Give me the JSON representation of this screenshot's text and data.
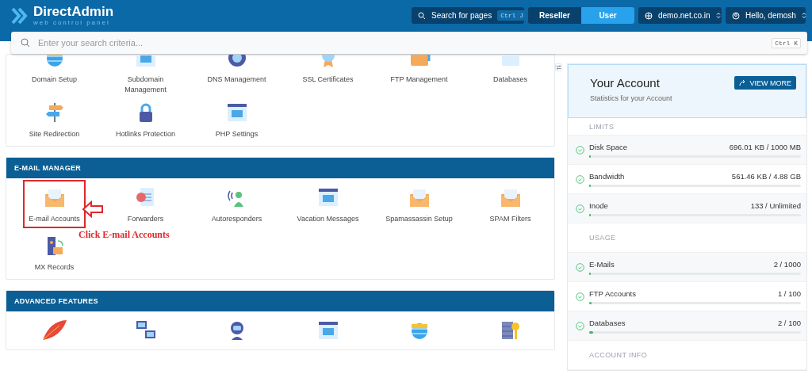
{
  "header": {
    "logo": {
      "name": "DirectAdmin",
      "tagline": "web control panel"
    },
    "page_search": {
      "label": "Search for pages",
      "shortcut": "Ctrl J"
    },
    "roles": [
      {
        "label": "Reseller",
        "selected": false
      },
      {
        "label": "User",
        "selected": true
      }
    ],
    "domain": "demo.net.co.in",
    "user": "Hello, demosh"
  },
  "search": {
    "placeholder": "Enter your search criteria...",
    "shortcut": "Ctrl K"
  },
  "sections": [
    {
      "items": [
        {
          "label": "Domain Setup",
          "highlighted": false
        },
        {
          "label": "Subdomain Management",
          "highlighted": false
        },
        {
          "label": "DNS Management",
          "highlighted": false
        },
        {
          "label": "SSL Certificates",
          "highlighted": false
        },
        {
          "label": "FTP Management",
          "highlighted": false
        },
        {
          "label": "Databases",
          "highlighted": false
        },
        {
          "label": "Site Redirection",
          "highlighted": false
        },
        {
          "label": "Hotlinks Protection",
          "highlighted": false
        },
        {
          "label": "PHP Settings",
          "highlighted": false
        }
      ]
    },
    {
      "title": "E-MAIL MANAGER",
      "annotation": "Click E-mail Accounts",
      "items": [
        {
          "label": "E-mail Accounts",
          "highlighted": true
        },
        {
          "label": "Forwarders",
          "highlighted": false
        },
        {
          "label": "Autoresponders",
          "highlighted": false
        },
        {
          "label": "Vacation Messages",
          "highlighted": false
        },
        {
          "label": "Spamassassin Setup",
          "highlighted": false
        },
        {
          "label": "SPAM Filters",
          "highlighted": false
        },
        {
          "label": "MX Records",
          "highlighted": false
        }
      ]
    },
    {
      "title": "ADVANCED FEATURES"
    }
  ],
  "account": {
    "title": "Your Account",
    "subtitle": "Statistics for your Account",
    "button": "VIEW MORE",
    "rows": [
      {
        "kind": "heading",
        "label": "LIMITS"
      },
      {
        "kind": "stat",
        "label": "Disk Space",
        "reading": "696.01 KB / 1000 MB",
        "level": 0.005
      },
      {
        "kind": "stat",
        "label": "Bandwidth",
        "reading": "561.46 KB / 4.88 GB",
        "level": 0.005
      },
      {
        "kind": "stat",
        "label": "Inode",
        "reading": "133 / Unlimited",
        "level": 0.005
      },
      {
        "kind": "heading",
        "label": "USAGE"
      },
      {
        "kind": "stat",
        "label": "E-Mails",
        "reading": "2 / 1000",
        "level": 0.005
      },
      {
        "kind": "stat",
        "label": "FTP Accounts",
        "reading": "1 / 100",
        "level": 0.01
      },
      {
        "kind": "stat",
        "label": "Databases",
        "reading": "2 / 100",
        "level": 0.02
      },
      {
        "kind": "heading",
        "label": "ACCOUNT INFO"
      }
    ]
  }
}
